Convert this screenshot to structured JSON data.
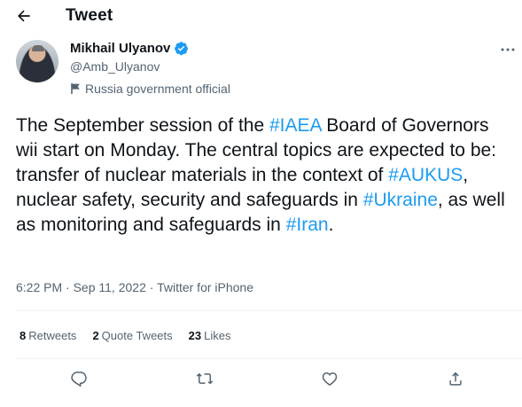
{
  "header": {
    "title": "Tweet",
    "back_icon": "arrow-left-icon"
  },
  "author": {
    "name": "Mikhail Ulyanov",
    "handle": "@Amb_Ulyanov",
    "label": "Russia government official",
    "verified_icon": "verified-badge-icon",
    "label_icon": "flag-icon"
  },
  "tweet": {
    "segments": [
      {
        "text": "The September session of the ",
        "type": "text"
      },
      {
        "text": "#IAEA",
        "type": "hashtag"
      },
      {
        "text": " Board of Governors wii start on Monday. The central topics are expected to be: transfer of nuclear materials in the context of ",
        "type": "text"
      },
      {
        "text": "#AUKUS",
        "type": "hashtag"
      },
      {
        "text": ", nuclear safety, security and safeguards in ",
        "type": "text"
      },
      {
        "text": "#Ukraine",
        "type": "hashtag"
      },
      {
        "text": ", as well as monitoring and safeguards in ",
        "type": "text"
      },
      {
        "text": "#Iran",
        "type": "hashtag"
      },
      {
        "text": ".",
        "type": "text"
      }
    ],
    "time": "6:22 PM",
    "separator": " · ",
    "date": "Sep 11, 2022",
    "source": "Twitter for iPhone"
  },
  "stats": {
    "retweets_count": "8",
    "retweets_label": "Retweets",
    "quotes_count": "2",
    "quotes_label": "Quote Tweets",
    "likes_count": "23",
    "likes_label": "Likes"
  },
  "actions": [
    "reply-icon",
    "retweet-icon",
    "like-icon",
    "share-icon"
  ],
  "colors": {
    "accent": "#1d9bf0",
    "text": "#0f1419",
    "secondary": "#536471",
    "divider": "#eff3f4"
  }
}
